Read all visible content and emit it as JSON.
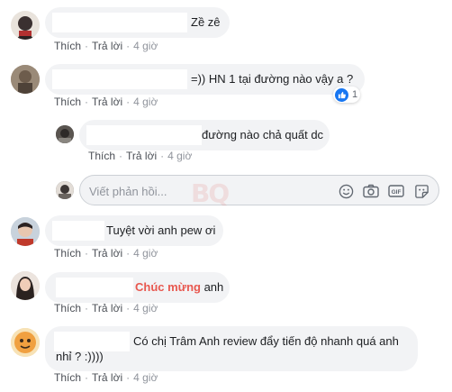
{
  "accent_color": "#1877f2",
  "highlight_color": "#e8584f",
  "actions": {
    "like": "Thích",
    "reply": "Trả lời",
    "separator": "·"
  },
  "comments": [
    {
      "text": "Zề zê",
      "time": "4 giờ"
    },
    {
      "text": "=)) HN 1 tại đường nào vậy a ?",
      "time": "4 giờ",
      "reactions": {
        "icon": "like-icon",
        "count": "1"
      }
    },
    {
      "text": "đường nào chả quất dc",
      "time": "4 giờ"
    },
    {
      "text": "Tuyệt vời anh pew ơi",
      "time": "4 giờ"
    },
    {
      "highlight": "Chúc mừng",
      "text": " anh",
      "time": "4 giờ"
    },
    {
      "line1": "Có chị Trâm Anh review đẩy tiến độ nhanh quá anh",
      "line2": "nhỉ ? :))))",
      "time": "4 giờ"
    }
  ],
  "reply_box": {
    "placeholder": "Viết phản hồi...",
    "tools": [
      "emoji-icon",
      "camera-icon",
      "gif-icon",
      "sticker-icon"
    ],
    "gif_label": "GIF"
  },
  "watermark": "BQ"
}
